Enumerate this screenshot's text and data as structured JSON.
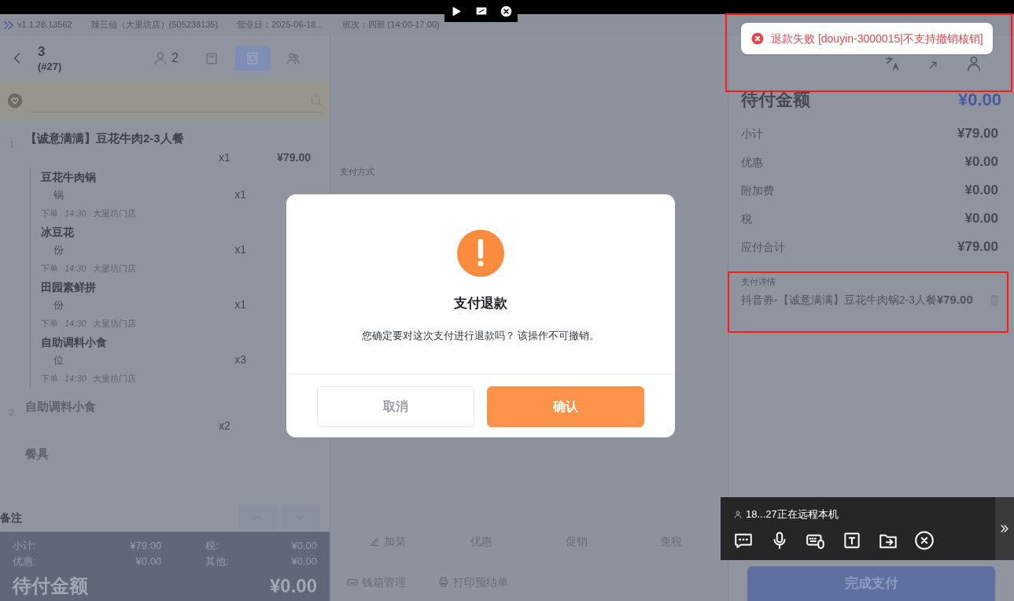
{
  "app_header": {
    "version": "v1.1.28.13562",
    "store": "辣三仙（大里坊店）(505238135)",
    "business_day": "营业日：2025-06-18...",
    "shift": "班次：四班 (14:00-17:00)"
  },
  "order_header": {
    "table": "3",
    "order_no": "(#27)",
    "tabs": [
      {
        "kind": "guests",
        "count": "2",
        "selected": false
      },
      {
        "kind": "bag",
        "selected": false
      },
      {
        "kind": "receipt",
        "selected": true
      },
      {
        "kind": "people",
        "selected": false
      }
    ]
  },
  "order_items": [
    {
      "index": "1",
      "name": "【诚意满满】豆花牛肉2-3人餐",
      "qty": "x1",
      "price": "¥79.00",
      "children": [
        {
          "name": "豆花牛肉锅",
          "unit": "锅",
          "qty": "x1",
          "order_label": "下单",
          "time": "14:30",
          "store": "大里坊门店"
        },
        {
          "name": "冰豆花",
          "unit": "份",
          "qty": "x1",
          "order_label": "下单",
          "time": "14:30",
          "store": "大里坊门店"
        },
        {
          "name": "田园素鲜拼",
          "unit": "份",
          "qty": "x1",
          "order_label": "下单",
          "time": "14:30",
          "store": "大里坊门店"
        },
        {
          "name": "自助调料小食",
          "unit": "位",
          "qty": "x3",
          "order_label": "下单",
          "time": "14:30",
          "store": "大里坊门店"
        }
      ]
    },
    {
      "index": "2",
      "name": "自助调料小食",
      "qty": "x2"
    },
    {
      "name": "餐具"
    }
  ],
  "remark_label": "备注",
  "left_summary": {
    "rows": [
      {
        "label": "小计:",
        "value": "¥79.00"
      },
      {
        "label": "税:",
        "value": "¥0.00"
      },
      {
        "label": "优惠:",
        "value": "¥0.00"
      },
      {
        "label": "其他:",
        "value": "¥0.00"
      }
    ],
    "due_label": "待付金额",
    "due_value": "¥0.00"
  },
  "middle": {
    "payment_methods_label": "支付方式",
    "actions": [
      "加菜",
      "优惠",
      "促销",
      "免税"
    ],
    "footer_actions": [
      "钱箱管理",
      "打印预结单"
    ]
  },
  "right": {
    "due_label": "待付金额",
    "due_value": "¥0.00",
    "rows": [
      {
        "label": "小计",
        "value": "¥79.00"
      },
      {
        "label": "优惠",
        "value": "¥0.00"
      },
      {
        "label": "附加费",
        "value": "¥0.00"
      },
      {
        "label": "税",
        "value": "¥0.00"
      },
      {
        "label": "应付合计",
        "value": "¥79.00"
      }
    ],
    "payment_details_label": "支付详情",
    "payments": [
      {
        "text": "抖音券-【诚意满满】豆花牛肉锅2-3人餐",
        "amount": "¥79.00"
      }
    ],
    "complete_button": "完成支付"
  },
  "toast": {
    "text": "退款失败 [douyin-3000015|不支持撤销核销]"
  },
  "dialog": {
    "title": "支付退款",
    "message": "您确定要对这次支付进行退款吗？ 该操作不可撤销。",
    "buttons": [
      {
        "label": "取消",
        "kind": "secondary"
      },
      {
        "label": "确认",
        "kind": "primary"
      }
    ]
  },
  "remote_panel": {
    "status": "18...27正在远程本机"
  }
}
